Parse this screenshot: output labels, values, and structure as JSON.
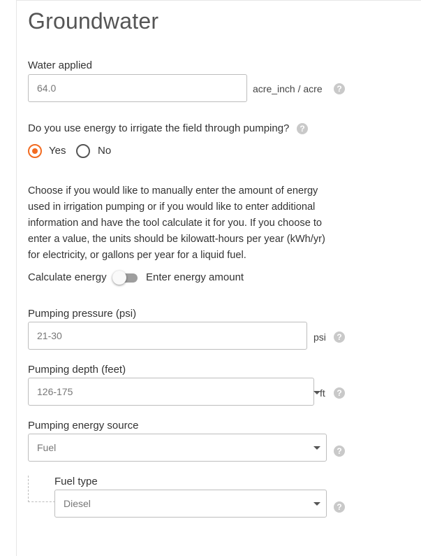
{
  "section": {
    "title": "Groundwater"
  },
  "water_applied": {
    "label": "Water applied",
    "value": "64.0",
    "unit": "acre_inch / acre"
  },
  "energy_question": {
    "label": "Do you use energy to irrigate the field through pumping?",
    "options": [
      {
        "label": "Yes",
        "selected": true
      },
      {
        "label": "No",
        "selected": false
      }
    ]
  },
  "info_paragraph": "Choose if you would like to manually enter the amount of energy used in irrigation pumping or if you would like to enter additional information and have the tool calculate it for you. If you choose to enter a value, the units should be kilowatt-hours per year (kWh/yr) for electricity, or gallons per year for a liquid fuel.",
  "energy_toggle": {
    "left_label": "Calculate energy",
    "right_label": "Enter energy amount",
    "state": "calculate"
  },
  "pumping_pressure": {
    "label": "Pumping pressure (psi)",
    "value": "21-30",
    "unit": "psi"
  },
  "pumping_depth": {
    "label": "Pumping depth (feet)",
    "value": "126-175",
    "unit": "ft"
  },
  "energy_source": {
    "label": "Pumping energy source",
    "value": "Fuel"
  },
  "fuel_type": {
    "label": "Fuel type",
    "value": "Diesel"
  },
  "help_glyph": "?",
  "colors": {
    "accent": "#f26b21",
    "border": "#bdbdbd",
    "help_icon": "#c9c9c9",
    "text": "#333333"
  }
}
